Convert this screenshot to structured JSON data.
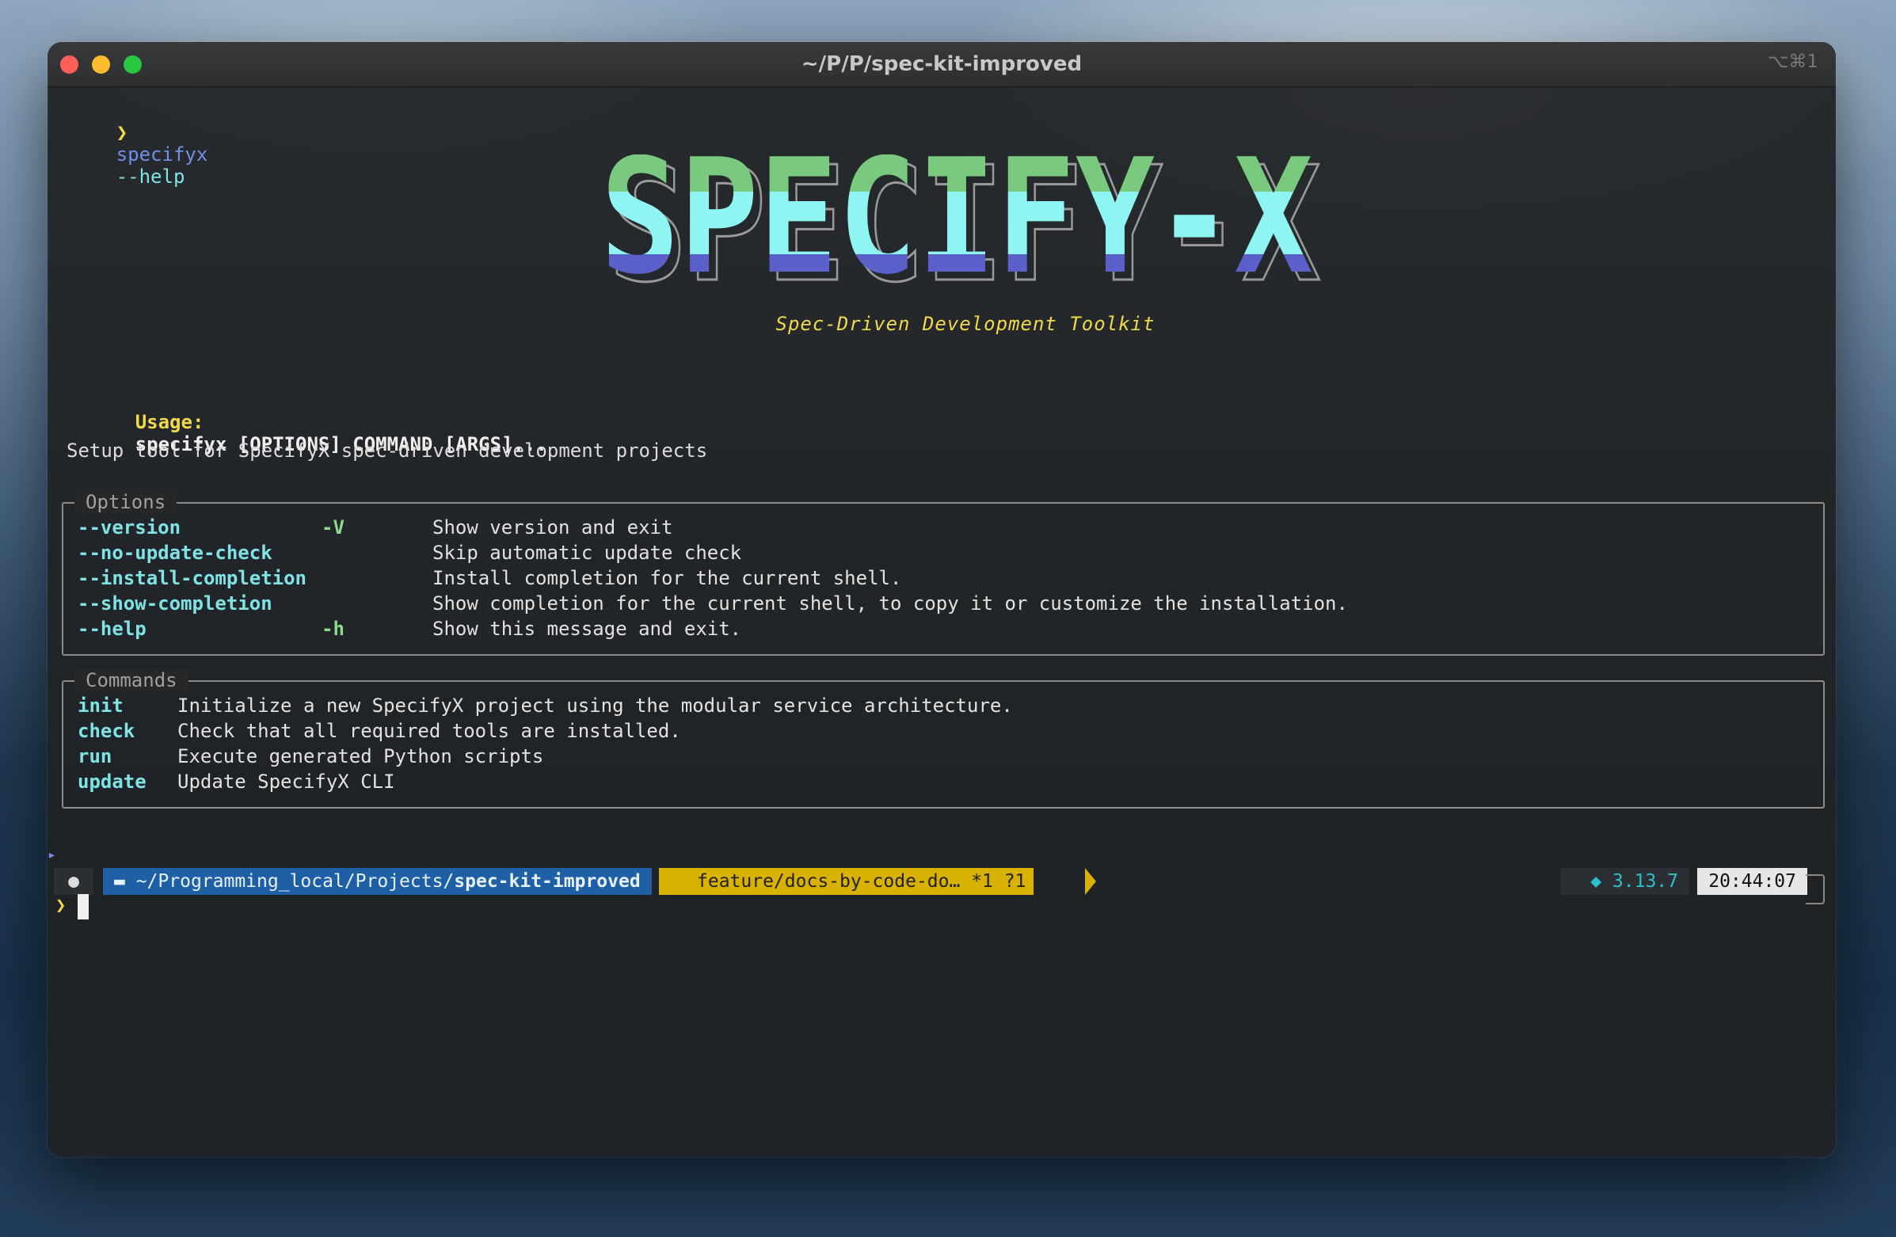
{
  "window": {
    "title": "~/P/P/spec-kit-improved",
    "shortcut": "⌥⌘1"
  },
  "command_line": {
    "prompt_glyph": "❯",
    "program": "specifyx",
    "args": "--help"
  },
  "banner": {
    "logo_text": "SPECIFY-X",
    "tagline": "Spec-Driven Development Toolkit",
    "colors": [
      "#79c97e",
      "#8ef5f2",
      "#5a5fc9"
    ]
  },
  "usage": {
    "label": "Usage:",
    "text": "specifyx [OPTIONS] COMMAND [ARGS]..."
  },
  "description": "Setup tool for SpecifyX spec-driven development projects",
  "options_panel": {
    "title": "Options",
    "rows": [
      {
        "flag": "--version",
        "short": "-V",
        "desc": "Show version and exit"
      },
      {
        "flag": "--no-update-check",
        "short": "",
        "desc": "Skip automatic update check"
      },
      {
        "flag": "--install-completion",
        "short": "",
        "desc": "Install completion for the current shell."
      },
      {
        "flag": "--show-completion",
        "short": "",
        "desc": "Show completion for the current shell, to copy it or customize the installation."
      },
      {
        "flag": "--help",
        "short": "-h",
        "desc": "Show this message and exit."
      }
    ]
  },
  "commands_panel": {
    "title": "Commands",
    "rows": [
      {
        "name": "init",
        "desc": "Initialize a new SpecifyX project using the modular service architecture."
      },
      {
        "name": "check",
        "desc": "Check that all required tools are installed."
      },
      {
        "name": "run",
        "desc": "Execute generated Python scripts"
      },
      {
        "name": "update",
        "desc": "Update SpecifyX CLI"
      }
    ]
  },
  "prompt_bar": {
    "os_icon": "apple-icon",
    "path_prefix": "~/Programming_local/Projects/",
    "path_current": "spec-kit-improved",
    "git_branch": "feature/docs-by-code-do…",
    "git_status": "*1 ?1",
    "python_version": "3.13.7",
    "time": "20:44:07",
    "second_prompt_glyph": "❯",
    "colors": {
      "path": "#1f5fa6",
      "git": "#d9b100",
      "python": "#2cc0c8"
    }
  }
}
